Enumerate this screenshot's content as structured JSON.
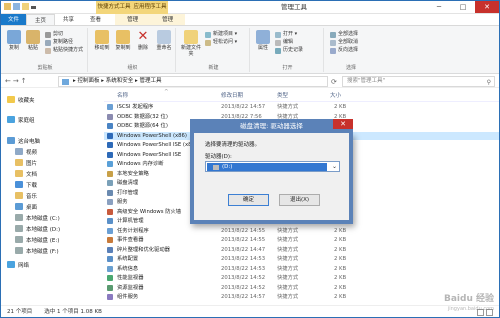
{
  "window": {
    "title": "管理工具",
    "min": "─",
    "max": "□",
    "close": "✕"
  },
  "contextual": {
    "label1": "快捷方式工具",
    "label2": "应用程序工具"
  },
  "tabs": [
    {
      "label": "文件"
    },
    {
      "label": "主页"
    },
    {
      "label": "共享"
    },
    {
      "label": "查看"
    },
    {
      "label": "管理"
    },
    {
      "label": "管理"
    }
  ],
  "ribbon": {
    "clipboard": {
      "label": "剪贴板",
      "copy": "复制",
      "paste": "粘贴",
      "cut": "剪切",
      "copy_path": "复制路径",
      "paste_shortcut": "粘贴快捷方式"
    },
    "organize": {
      "label": "组织",
      "move_to": "移动到",
      "copy_to": "复制到",
      "delete": "删除",
      "rename": "重命名"
    },
    "new": {
      "label": "新建",
      "new_folder": "新建文件夹",
      "new_item": "新建项目 ▾",
      "easy_access": "轻松访问 ▾"
    },
    "open": {
      "label": "打开",
      "properties": "属性",
      "open_btn": "打开 ▾",
      "edit": "编辑",
      "history": "历史记录"
    },
    "select": {
      "label": "选择",
      "select_all": "全部选择",
      "select_none": "全部取消",
      "invert": "反向选择"
    }
  },
  "address": {
    "back": "←",
    "forward": "→",
    "up": "↑",
    "path": "▸ 控制面板 ▸ 系统和安全 ▸ 管理工具",
    "refresh": "⟳",
    "search_placeholder": "搜索\"管理工具\"",
    "search_icon": "⚲"
  },
  "nav": {
    "favorites": "收藏夹",
    "homegroup": "家庭组",
    "this_pc": "这台电脑",
    "video": "视频",
    "pictures": "图片",
    "documents": "文档",
    "downloads": "下载",
    "music": "音乐",
    "desktop": "桌面",
    "drive_c": "本地磁盘 (C:)",
    "drive_d": "本地磁盘 (D:)",
    "drive_e": "本地磁盘 (E:)",
    "drive_f": "本地磁盘 (F:)",
    "network": "网络"
  },
  "columns": {
    "name": "名称",
    "date": "修改日期",
    "type": "类型",
    "size": "大小",
    "sort_arrow": "^"
  },
  "files": [
    {
      "name": "iSCSI 发起程序",
      "date": "2013/8/22 14:57",
      "type": "快捷方式",
      "size": "2 KB"
    },
    {
      "name": "ODBC 数据源(32 位)",
      "date": "2013/8/22 7:56",
      "type": "快捷方式",
      "size": "2 KB"
    },
    {
      "name": "ODBC 数据源(64 位)",
      "date": "2013/8/22 14:59",
      "type": "快捷方式",
      "size": "2 KB"
    },
    {
      "name": "Windows PowerShell (x86)",
      "date": "2013/8/22 14:52",
      "type": "快捷方式",
      "size": "3 KB"
    },
    {
      "name": "Windows PowerShell ISE (x8",
      "date": "",
      "type": "",
      "size": "2 KB"
    },
    {
      "name": "Windows PowerShell ISE",
      "date": "",
      "type": "",
      "size": "2 KB"
    },
    {
      "name": "Windows 内存诊断",
      "date": "",
      "type": "",
      "size": "2 KB"
    },
    {
      "name": "本地安全策略",
      "date": "",
      "type": "",
      "size": "2 KB"
    },
    {
      "name": "磁盘清理",
      "date": "",
      "type": "",
      "size": "2 KB"
    },
    {
      "name": "打印管理",
      "date": "",
      "type": "",
      "size": "2 KB"
    },
    {
      "name": "服务",
      "date": "",
      "type": "",
      "size": "2 KB"
    },
    {
      "name": "高级安全 Windows 防火墙",
      "date": "",
      "type": "",
      "size": "2 KB"
    },
    {
      "name": "计算机管理",
      "date": "",
      "type": "",
      "size": "2 KB"
    },
    {
      "name": "任务计划程序",
      "date": "2013/8/22 14:55",
      "type": "快捷方式",
      "size": "2 KB"
    },
    {
      "name": "事件查看器",
      "date": "2013/8/22 14:55",
      "type": "快捷方式",
      "size": "2 KB"
    },
    {
      "name": "碎片整理和优化驱动器",
      "date": "2013/8/22 14:47",
      "type": "快捷方式",
      "size": "2 KB"
    },
    {
      "name": "系统配置",
      "date": "2013/8/22 14:53",
      "type": "快捷方式",
      "size": "2 KB"
    },
    {
      "name": "系统信息",
      "date": "2013/8/22 14:53",
      "type": "快捷方式",
      "size": "2 KB"
    },
    {
      "name": "性能监视器",
      "date": "2013/8/22 14:52",
      "type": "快捷方式",
      "size": "2 KB"
    },
    {
      "name": "资源监视器",
      "date": "2013/8/22 14:52",
      "type": "快捷方式",
      "size": "2 KB"
    },
    {
      "name": "组件服务",
      "date": "2013/8/22 14:57",
      "type": "快捷方式",
      "size": "2 KB"
    }
  ],
  "status": {
    "count": "21 个项目",
    "selected": "选中 1 个项目 1.08 KB"
  },
  "dialog": {
    "title": "磁盘清理: 驱动器选择",
    "close": "✕",
    "message": "选择要清理的驱动器。",
    "drive_label": "驱动器(D):",
    "selected_drive": "(D:)",
    "dropdown_arrow": "⌄",
    "ok": "确定",
    "exit": "退出(X)"
  },
  "watermark": {
    "line1": "Baidu 经验",
    "line2": "jingyan.baidu.com"
  },
  "colors": {
    "accent": "#1979ca",
    "dialog_frame": "#5b82b8",
    "close_red": "#c7312c",
    "selection": "#cce8ff"
  }
}
